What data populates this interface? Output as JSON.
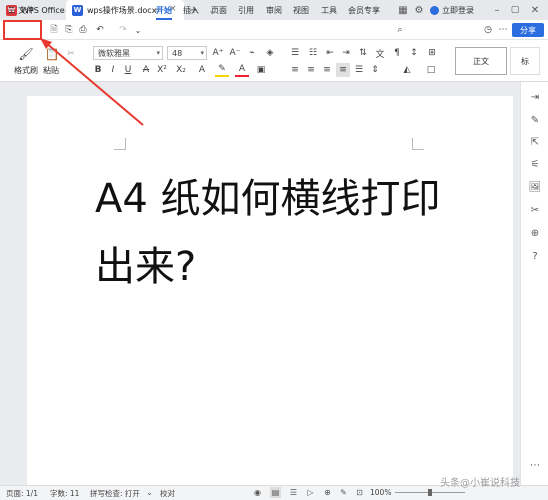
{
  "titlebar": {
    "app_tab": "WPS Office",
    "app_logo": "W",
    "doc_tab": "wps操作场景.docx",
    "doc_logo": "W",
    "login": "立即登录",
    "icons": [
      "monitor-icon",
      "close-icon",
      "plus-icon",
      "grid-icon",
      "settings-icon",
      "minimize-icon",
      "restore-icon",
      "close-window-icon"
    ]
  },
  "menu": {
    "file": "文件",
    "items": [
      "开始",
      "插入",
      "页面",
      "引用",
      "审阅",
      "视图",
      "工具",
      "会员专享"
    ],
    "active": "开始",
    "share": "分享"
  },
  "ribbon": {
    "format_painter": "格式刷",
    "paste": "粘贴",
    "font_name": "微软雅黑",
    "font_size": "48",
    "style_normal": "正文",
    "style_next": "标"
  },
  "document": {
    "line1": "A4 纸如何横线打印",
    "line2": "出来?"
  },
  "status": {
    "page": "页面: 1/1",
    "words": "字数: 11",
    "spell": "拼写检查: 打开",
    "proof": "校对",
    "zoom": "100%",
    "watermark": "头条@小崔说科技"
  },
  "annotation": {
    "color": "#e8392f"
  }
}
